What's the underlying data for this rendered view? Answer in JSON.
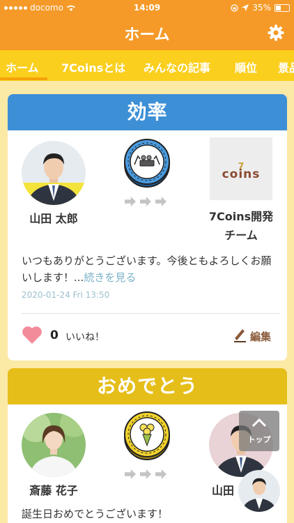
{
  "status_bar": {
    "carrier": "docomo",
    "time": "14:09",
    "battery": "35%"
  },
  "header": {
    "title": "ホーム"
  },
  "tabs": [
    {
      "label": "ホーム"
    },
    {
      "label": "7Coinsとは"
    },
    {
      "label": "みんなの記事"
    },
    {
      "label": "順位"
    },
    {
      "label": "景品"
    }
  ],
  "posts": [
    {
      "category": "効率",
      "category_color": "#3d8fd6",
      "sender": "山田 太郎",
      "receiver": "7Coins開発チーム",
      "receiver_logo": "coins",
      "message": "いつもありがとうございます。今後ともよろしくお願いします！...",
      "read_more": "続きを見る",
      "date": "2020-01-24 Fri 13:50",
      "like_count": "0",
      "like_label": "いいね！",
      "edit_label": "編集"
    },
    {
      "category": "おめでとう",
      "category_color": "#e6be1a",
      "sender": "斎藤 花子",
      "receiver": "山田",
      "message": "誕生日おめでとうございます！"
    }
  ],
  "scroll_top": {
    "label": "トップ"
  }
}
